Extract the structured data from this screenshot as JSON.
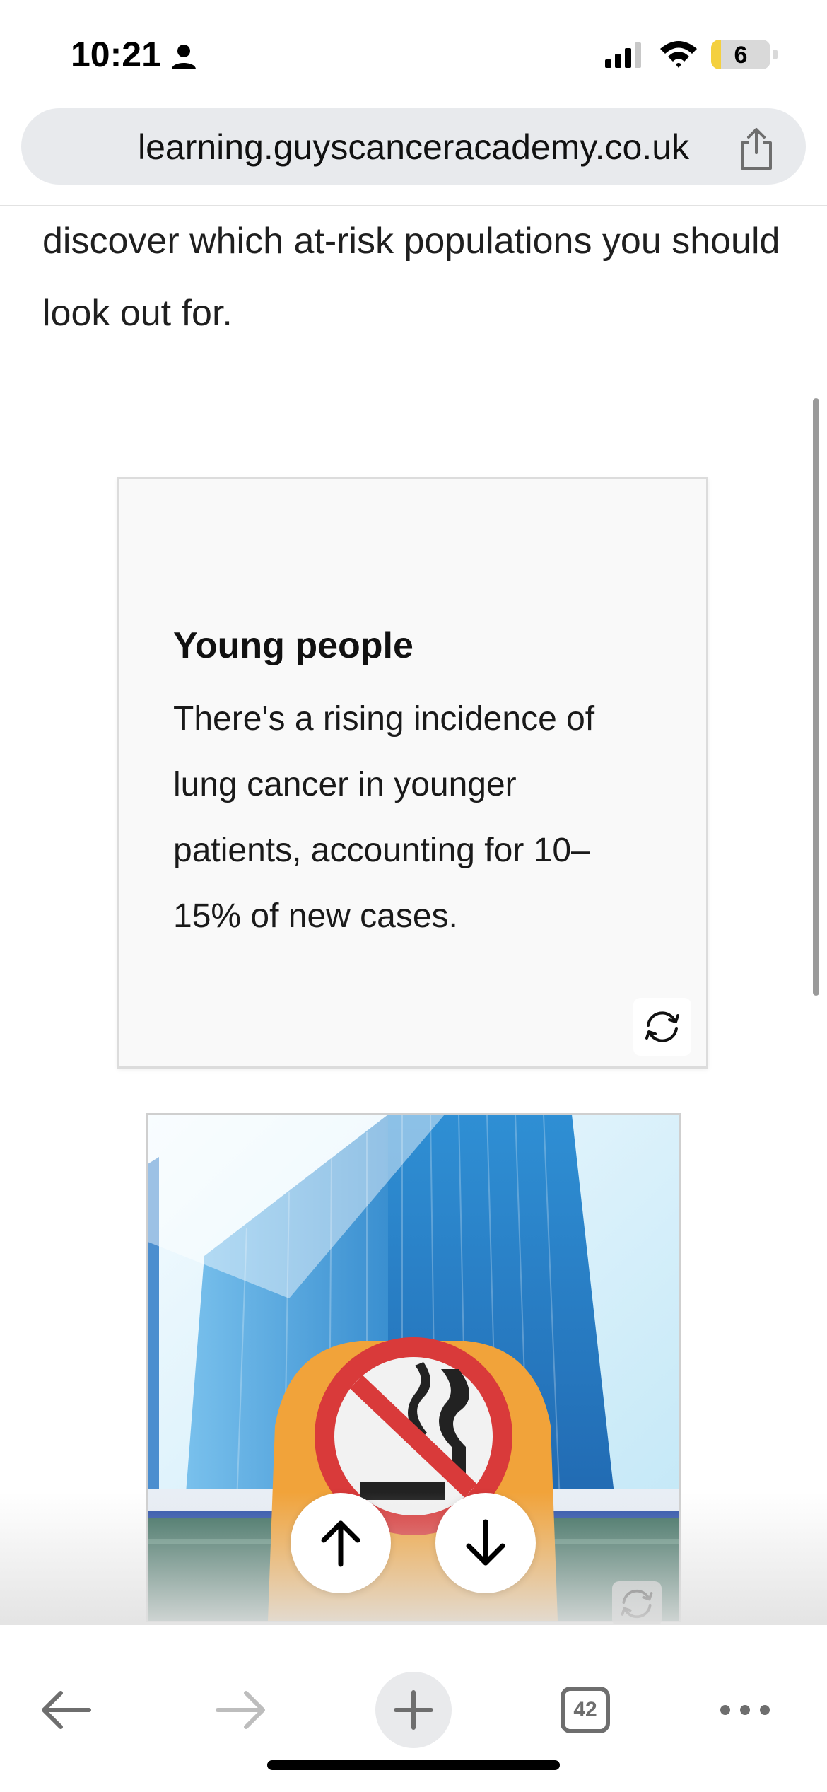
{
  "status_bar": {
    "time": "10:21",
    "battery_level": "6"
  },
  "browser": {
    "url": "learning.guyscanceracademy.co.uk",
    "tab_count": "42"
  },
  "content": {
    "intro_text": "discover which at-risk populations you should look out for.",
    "flip_card": {
      "title": "Young people",
      "body": "There's a rising incidence of lung cancer in younger patients, accounting for 10–15% of new cases."
    },
    "image_card": {
      "icon": "no-smoking-sign-photo"
    }
  },
  "icons": {
    "person": "person-icon",
    "signal": "signal-icon",
    "wifi": "wifi-icon",
    "share": "share-icon",
    "flip": "flip-icon",
    "up": "arrow-up-icon",
    "down": "arrow-down-icon",
    "back": "back-arrow-icon",
    "forward": "forward-arrow-icon",
    "new_tab": "plus-icon",
    "more": "more-icon"
  },
  "colors": {
    "battery_fill": "#f4d03f",
    "url_bar": "#e8eaed",
    "toolbar_icon": "#6e6e6e"
  }
}
